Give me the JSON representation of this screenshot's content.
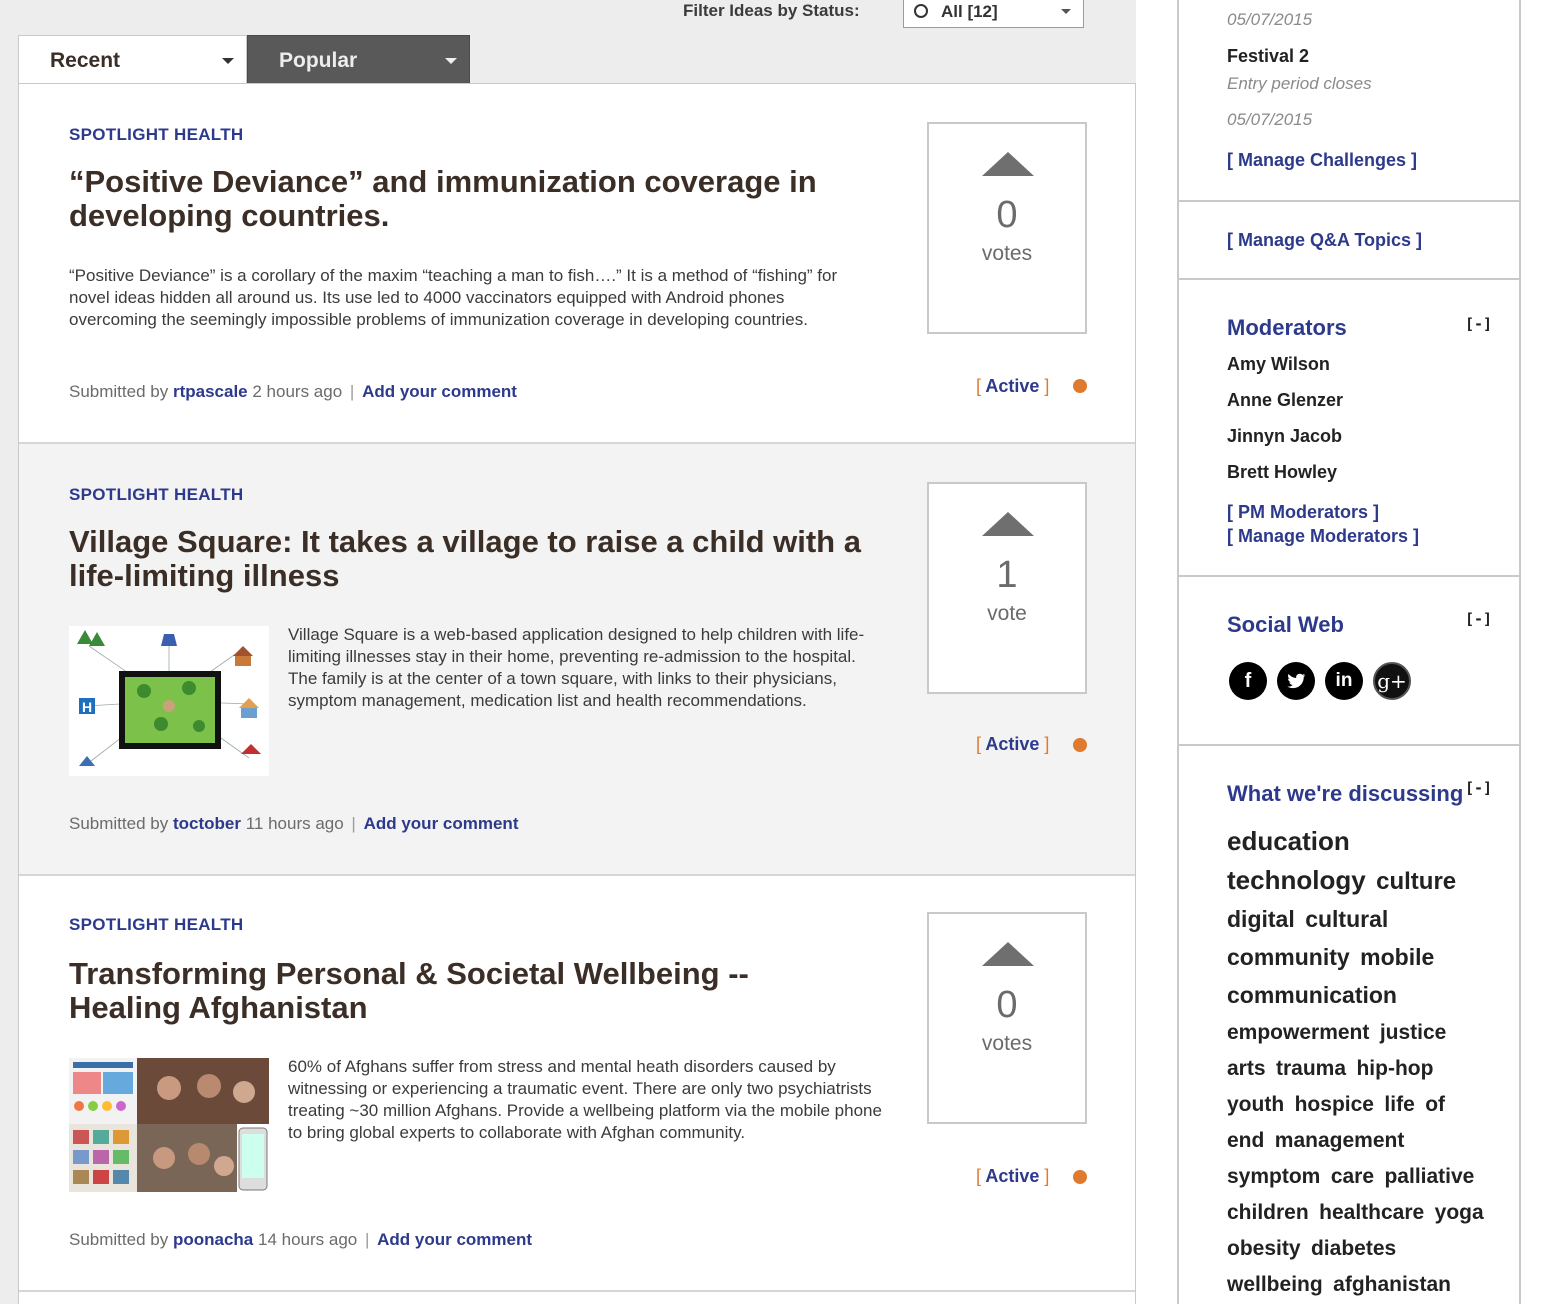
{
  "filter": {
    "label": "Filter Ideas by Status:",
    "value": "All [12]"
  },
  "tabs": [
    {
      "label": "Recent"
    },
    {
      "label": "Popular"
    }
  ],
  "ideas": [
    {
      "category": "SPOTLIGHT HEALTH",
      "title": "“Positive Deviance” and immunization coverage in developing countries.",
      "description": "“Positive Deviance” is a corollary of the maxim “teaching a man to fish….” It is a method of “fishing” for novel ideas hidden all around us. Its use led to 4000 vaccinators equipped with Android phones overcoming the seemingly impossible problems of immunization coverage in developing countries.",
      "submitted_prefix": "Submitted by",
      "author": "rtpascale",
      "time": "2 hours ago",
      "sep": "|",
      "comment": "Add your comment",
      "votes": "0",
      "votes_label": "votes",
      "status": "Active",
      "status_color": "#e07a2e"
    },
    {
      "category": "SPOTLIGHT HEALTH",
      "title": "Village Square: It takes a village to raise a child with a life-limiting illness",
      "description": "Village Square is a web-based application designed to help children with life-limiting illnesses stay in their home, preventing re-admission to the hospital. The family is at the center of a town square, with links to their physicians, symptom management, medication list and health recommendations.",
      "submitted_prefix": "Submitted by",
      "author": "toctober",
      "time": "11 hours ago",
      "sep": "|",
      "comment": "Add your comment",
      "votes": "1",
      "votes_label": "vote",
      "status": "Active",
      "status_color": "#e07a2e"
    },
    {
      "category": "SPOTLIGHT HEALTH",
      "title": "Transforming Personal & Societal Wellbeing -- Healing Afghanistan",
      "description": "60% of Afghans suffer from stress and mental heath disorders caused by witnessing or experiencing a traumatic event. There are only two psychiatrists treating ~30 million Afghans. Provide a wellbeing platform via the mobile phone to bring global experts to collaborate with Afghan community.",
      "submitted_prefix": "Submitted by",
      "author": "poonacha",
      "time": "14 hours ago",
      "sep": "|",
      "comment": "Add your comment",
      "votes": "0",
      "votes_label": "votes",
      "status": "Active",
      "status_color": "#e07a2e"
    }
  ],
  "sidebar": {
    "challenges": {
      "date1": "05/07/2015",
      "festival": "Festival 2",
      "entry": "Entry period closes",
      "date2": "05/07/2015",
      "manage": "[ Manage Challenges ]"
    },
    "qa": {
      "manage": "[ Manage Q&A Topics ]"
    },
    "moderators": {
      "heading": "Moderators",
      "toggle": "[-]",
      "names": [
        "Amy Wilson",
        "Anne Glenzer",
        "Jinnyn Jacob",
        "Brett Howley"
      ],
      "pm": "[ PM Moderators ]",
      "manage": "[ Manage Moderators ]"
    },
    "social": {
      "heading": "Social Web",
      "toggle": "[-]",
      "icons": [
        "facebook-icon",
        "twitter-icon",
        "linkedin-icon",
        "google-plus-icon"
      ]
    },
    "discussing": {
      "heading": "What we're discussing",
      "toggle": "[-]",
      "tags": [
        {
          "t": "education",
          "s": 26
        },
        {
          "t": "technology",
          "s": 26
        },
        {
          "t": "culture",
          "s": 24
        },
        {
          "t": "digital",
          "s": 23
        },
        {
          "t": "cultural",
          "s": 23
        },
        {
          "t": "community",
          "s": 23
        },
        {
          "t": "mobile",
          "s": 23
        },
        {
          "t": "communication",
          "s": 23
        },
        {
          "t": "empowerment",
          "s": 21
        },
        {
          "t": "justice",
          "s": 21
        },
        {
          "t": "arts",
          "s": 21
        },
        {
          "t": "trauma",
          "s": 21
        },
        {
          "t": "hip-hop",
          "s": 21
        },
        {
          "t": "youth",
          "s": 21
        },
        {
          "t": "hospice",
          "s": 21
        },
        {
          "t": "life",
          "s": 21
        },
        {
          "t": "of",
          "s": 21
        },
        {
          "t": "end",
          "s": 21
        },
        {
          "t": "management",
          "s": 21
        },
        {
          "t": "symptom",
          "s": 21
        },
        {
          "t": "care",
          "s": 21
        },
        {
          "t": "palliative",
          "s": 21
        },
        {
          "t": "children",
          "s": 21
        },
        {
          "t": "healthcare",
          "s": 21
        },
        {
          "t": "yoga",
          "s": 21
        },
        {
          "t": "obesity",
          "s": 21
        },
        {
          "t": "diabetes",
          "s": 21
        },
        {
          "t": "wellbeing",
          "s": 21
        },
        {
          "t": "afghanistan",
          "s": 21
        }
      ]
    }
  }
}
